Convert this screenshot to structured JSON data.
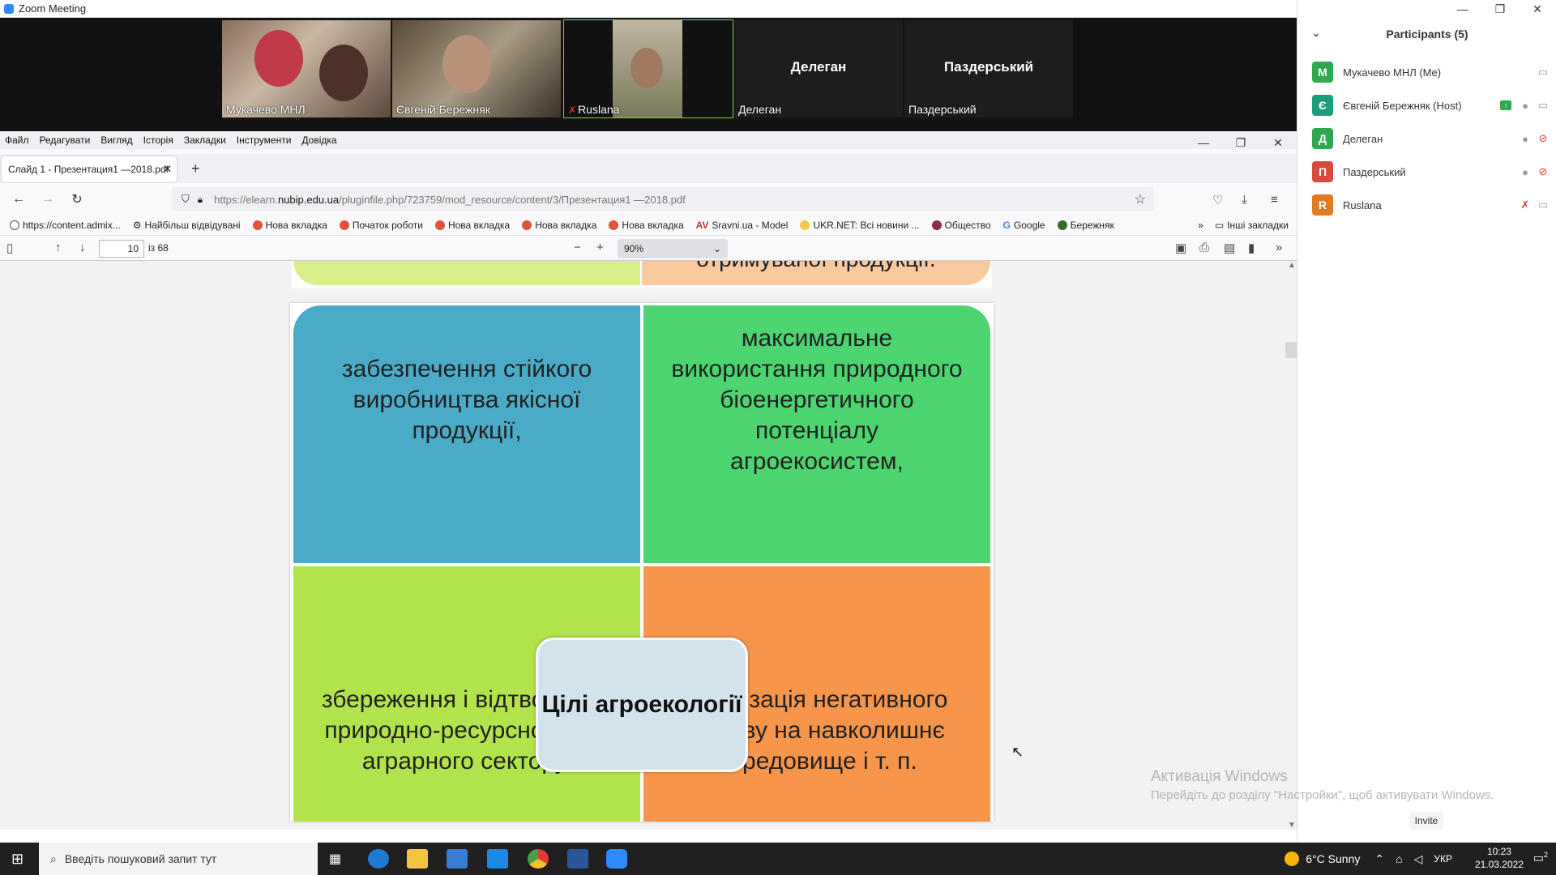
{
  "zoom": {
    "title": "Zoom Meeting",
    "videos": [
      {
        "name": "Мукачево МНЛ",
        "big": "",
        "muted": false,
        "active": false
      },
      {
        "name": "Євгеній Бережняк",
        "big": "",
        "muted": false,
        "active": false
      },
      {
        "name": "Ruslana",
        "big": "",
        "muted": true,
        "active": true
      },
      {
        "name": "Делеган",
        "big": "Делеган",
        "muted": false,
        "active": false
      },
      {
        "name": "Паздерський",
        "big": "Паздерський",
        "muted": false,
        "active": false
      }
    ],
    "participants_header": "Participants (5)",
    "participants": [
      {
        "initial": "M",
        "name": "Мукачево МНЛ (Me)",
        "color": "#2fa84f"
      },
      {
        "initial": "Є",
        "name": "Євгеній Бережняк (Host)",
        "color": "#1a9d7a"
      },
      {
        "initial": "Д",
        "name": "Делеган",
        "color": "#2fa84f"
      },
      {
        "initial": "П",
        "name": "Паздерський",
        "color": "#d84a3a"
      },
      {
        "initial": "R",
        "name": "Ruslana",
        "color": "#e07b22"
      }
    ],
    "invite_label": "Invite"
  },
  "windows_watermark": {
    "line1": "Активація Windows",
    "line2": "Перейдіть до розділу \"Настройки\", щоб активувати Windows."
  },
  "firefox": {
    "menu": [
      "Файл",
      "Редагувати",
      "Вигляд",
      "Історія",
      "Закладки",
      "Інструменти",
      "Довідка"
    ],
    "tab_title": "Слайд 1 - Презентация1 —2018.pdf",
    "url_prefix": "https://elearn.",
    "url_domain": "nubip.edu.ua",
    "url_rest": "/pluginfile.php/723759/mod_resource/content/3/Презентация1 —2018.pdf",
    "bookmarks": [
      "https://content.admix...",
      "Найбільш відвідувані",
      "Нова вкладка",
      "Початок роботи",
      "Нова вкладка",
      "Нова вкладка",
      "Нова вкладка",
      "Sravni.ua - Model",
      "UKR.NET: Всі новини ...",
      "Общество",
      "Google",
      "Бережняк"
    ],
    "other_bookmarks": "Інші закладки"
  },
  "pdf": {
    "page": "10",
    "page_count": "із 68",
    "zoom": "90%",
    "top_fragment": "отримуваної продукції.",
    "slide": {
      "top_left": "забезпечення стійкого виробництва якісної продукції,",
      "top_right": "максимальне використання природного біоенергетичного потенціалу агроекосистем,",
      "bottom_left": "збереження і відтворення природно-ресурсної бази аграрного сектору,",
      "bottom_right": "мінімізація негативного впливу на навколишнє середовище і т. п.",
      "center": "Цілі агроекології",
      "colors": {
        "top_left": "#4aabc6",
        "top_right": "#4cd470",
        "bottom_left": "#b0e44a",
        "bottom_right": "#f7964a"
      }
    }
  },
  "taskbar": {
    "search_placeholder": "Введіть пошуковий запит тут",
    "weather": "6°C  Sunny",
    "lang": "УКР",
    "time": "10:23",
    "date": "21.03.2022",
    "notifications": "2"
  }
}
